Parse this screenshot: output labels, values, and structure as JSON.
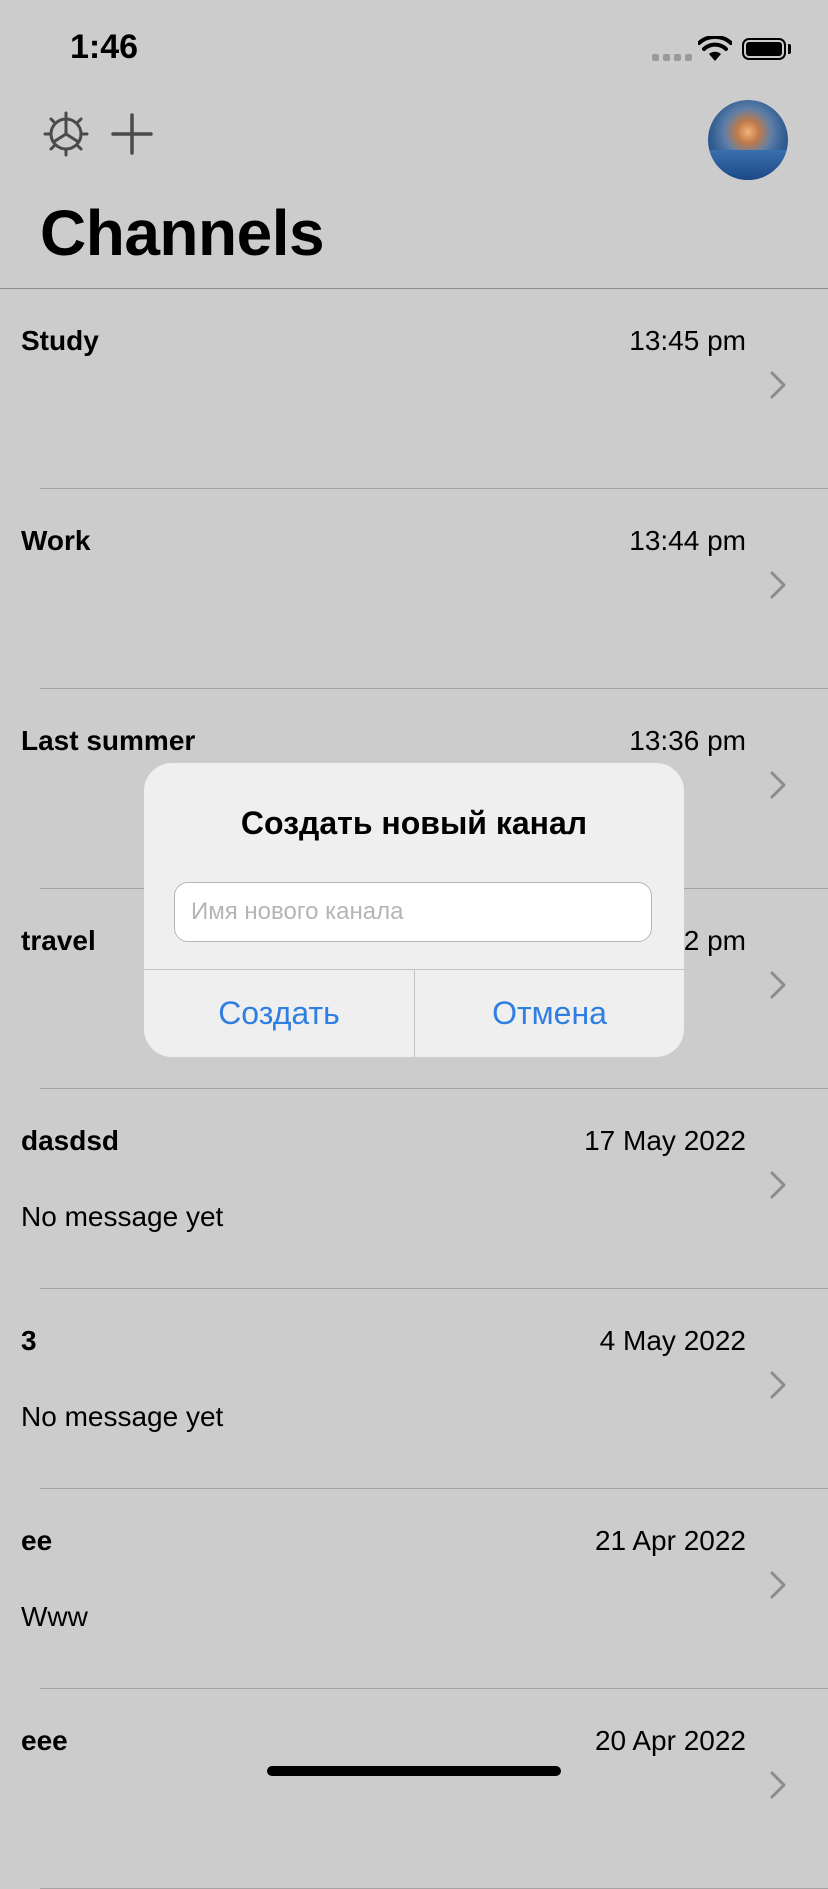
{
  "status_bar": {
    "time": "1:46"
  },
  "nav": {
    "title": "Channels",
    "icons": [
      "gear-icon",
      "plus-icon"
    ]
  },
  "channels": [
    {
      "name": "Study",
      "date": "13:45 pm",
      "message": ""
    },
    {
      "name": "Work",
      "date": "13:44 pm",
      "message": ""
    },
    {
      "name": "Last summer",
      "date": "13:36 pm",
      "message": ""
    },
    {
      "name": "travel",
      "date": "13:32 pm",
      "message": ""
    },
    {
      "name": "dasdsd",
      "date": "17 May 2022",
      "message": "No message yet"
    },
    {
      "name": "3",
      "date": "4 May 2022",
      "message": "No message yet"
    },
    {
      "name": "ee",
      "date": "21 Apr 2022",
      "message": "Www"
    },
    {
      "name": "eee",
      "date": "20 Apr 2022",
      "message": ""
    }
  ],
  "dialog": {
    "title": "Создать новый канал",
    "input_placeholder": "Имя нового канала",
    "input_value": "",
    "create_label": "Создать",
    "cancel_label": "Отмена"
  },
  "colors": {
    "accent": "#2f7fe3",
    "background": "#cccccc",
    "dialog": "#efefef"
  }
}
